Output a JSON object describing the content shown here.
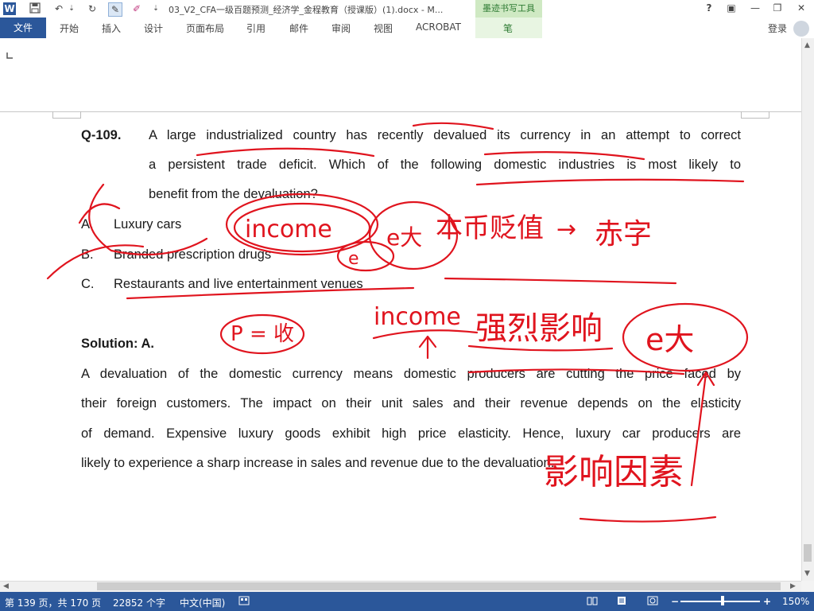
{
  "window": {
    "title": "03_V2_CFA一级百题预测_经济学_金程教育（授课版）(1).docx - M...",
    "ink_tools_header": "墨迹书写工具",
    "help_glyph": "?",
    "restore_glyph": "▣",
    "minimize_glyph": "—",
    "maximize_glyph": "❐",
    "close_glyph": "✕"
  },
  "quick_access": {
    "word_icon": "W",
    "save_icon": "save-icon",
    "undo_glyph": "↶",
    "redo_glyph": "↻",
    "pen_glyph": "✎",
    "marker_glyph": "✐",
    "more_glyph": "⇣"
  },
  "ribbon_tabs": {
    "file": "文件",
    "items": [
      "开始",
      "插入",
      "设计",
      "页面布局",
      "引用",
      "邮件",
      "审阅",
      "视图",
      "ACROBAT",
      "笔"
    ]
  },
  "account": {
    "login_label": "登录"
  },
  "document": {
    "question_number": "Q-109.",
    "question_lines": [
      "A large industrialized country has recently devalued its currency in an attempt to correct",
      "a persistent trade deficit. Which of the following domestic industries is most likely to",
      "benefit from the devaluation?"
    ],
    "options": [
      {
        "letter": "A.",
        "text": "Luxury cars"
      },
      {
        "letter": "B.",
        "text": "Branded prescription drugs"
      },
      {
        "letter": "C.",
        "text": "Restaurants and live entertainment venues"
      }
    ],
    "solution_label": "Solution: A.",
    "solution_lines": [
      "A devaluation of the domestic currency means domestic producers are cutting the price faced by",
      "their foreign customers. The impact on their unit sales and their revenue depends on the elasticity",
      "of demand. Expensive luxury goods exhibit high price elasticity. Hence, luxury car producers are",
      "likely to experience a sharp increase in sales and revenue due to the devaluation."
    ]
  },
  "ink_annotations": {
    "income_1": "income",
    "elast_1": "e大",
    "label_1": "本币贬值",
    "arrow": "→",
    "label_2": "赤字",
    "small_e": "e",
    "fp_label": "P = 收",
    "income_2": "income",
    "label_3": "强烈影响",
    "elast_2": "e大",
    "label_4": "影响因素"
  },
  "status": {
    "page": "第 139 页，共 170 页",
    "words": "22852 个字",
    "language": "中文(中国)",
    "zoom": "150%"
  },
  "colors": {
    "brand": "#2b579a",
    "ink": "#e0141e",
    "ink_tab": "#cfe9c3"
  }
}
